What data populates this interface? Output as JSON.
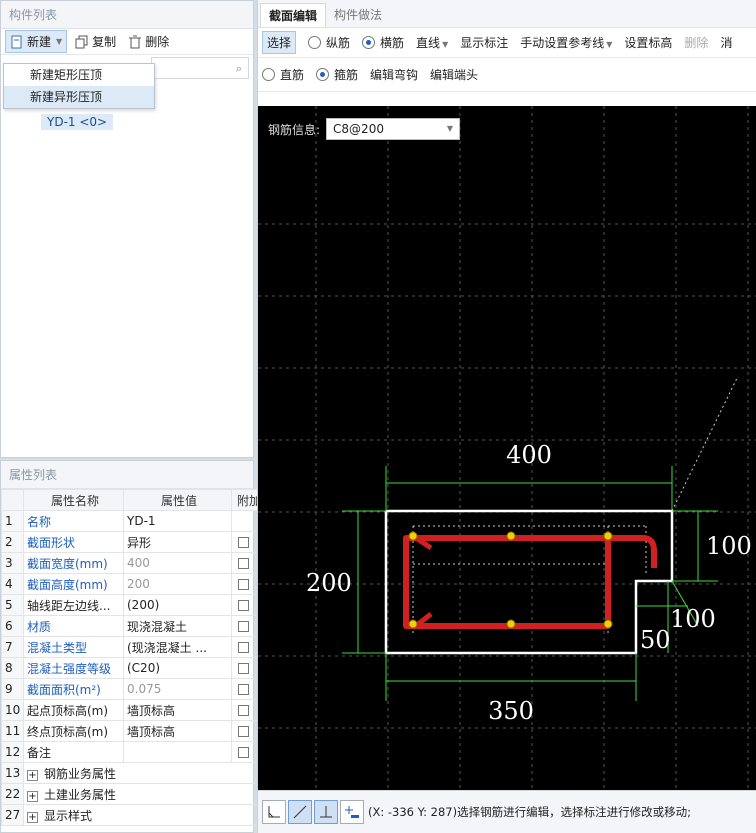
{
  "component_list": {
    "title": "构件列表",
    "new_label": "新建",
    "copy_label": "复制",
    "delete_label": "删除",
    "menu_items": [
      "新建矩形压顶",
      "新建异形压顶"
    ],
    "tree_item": "YD-1 <0>"
  },
  "property_list": {
    "title": "属性列表",
    "headers": [
      "属性名称",
      "属性值",
      "附加"
    ],
    "rows": [
      {
        "n": "1",
        "name": "名称",
        "value": "YD-1"
      },
      {
        "n": "2",
        "name": "截面形状",
        "value": "异形"
      },
      {
        "n": "3",
        "name": "截面宽度(mm)",
        "value": "400"
      },
      {
        "n": "4",
        "name": "截面高度(mm)",
        "value": "200"
      },
      {
        "n": "5",
        "name": "轴线距左边线...",
        "value": "(200)"
      },
      {
        "n": "6",
        "name": "材质",
        "value": "现浇混凝土"
      },
      {
        "n": "7",
        "name": "混凝土类型",
        "value": "(现浇混凝土",
        "extra": "..."
      },
      {
        "n": "8",
        "name": "混凝土强度等级",
        "value": "(C20)"
      },
      {
        "n": "9",
        "name": "截面面积(m²)",
        "value": "0.075"
      },
      {
        "n": "10",
        "name": "起点顶标高(m)",
        "value": "墙顶标高"
      },
      {
        "n": "11",
        "name": "终点顶标高(m)",
        "value": "墙顶标高"
      },
      {
        "n": "12",
        "name": "备注",
        "value": ""
      },
      {
        "n": "13",
        "name": "钢筋业务属性",
        "value": ""
      },
      {
        "n": "22",
        "name": "土建业务属性",
        "value": ""
      },
      {
        "n": "27",
        "name": "显示样式",
        "value": ""
      }
    ]
  },
  "editor": {
    "tabs": [
      "截面编辑",
      "构件做法"
    ],
    "toolbar1": {
      "select": "选择",
      "longitudinal": "纵筋",
      "transverse": "横筋",
      "line": "直线",
      "show_dims": "显示标注",
      "manual_ref": "手动设置参考线",
      "set_elev": "设置标高",
      "delete": "删除",
      "more": "消"
    },
    "toolbar2": {
      "straight": "直筋",
      "stirrup": "箍筋",
      "edit_hook": "编辑弯钩",
      "edit_end": "编辑端头"
    },
    "rebar_info_label": "钢筋信息:",
    "rebar_info_value": "C8@200",
    "dims": {
      "top": "400",
      "left": "200",
      "right": "100",
      "notch": "100",
      "small": "50",
      "bottom": "350"
    },
    "status": "(X: -336 Y: 287)选择钢筋进行编辑，选择标注进行修改或移动;"
  }
}
